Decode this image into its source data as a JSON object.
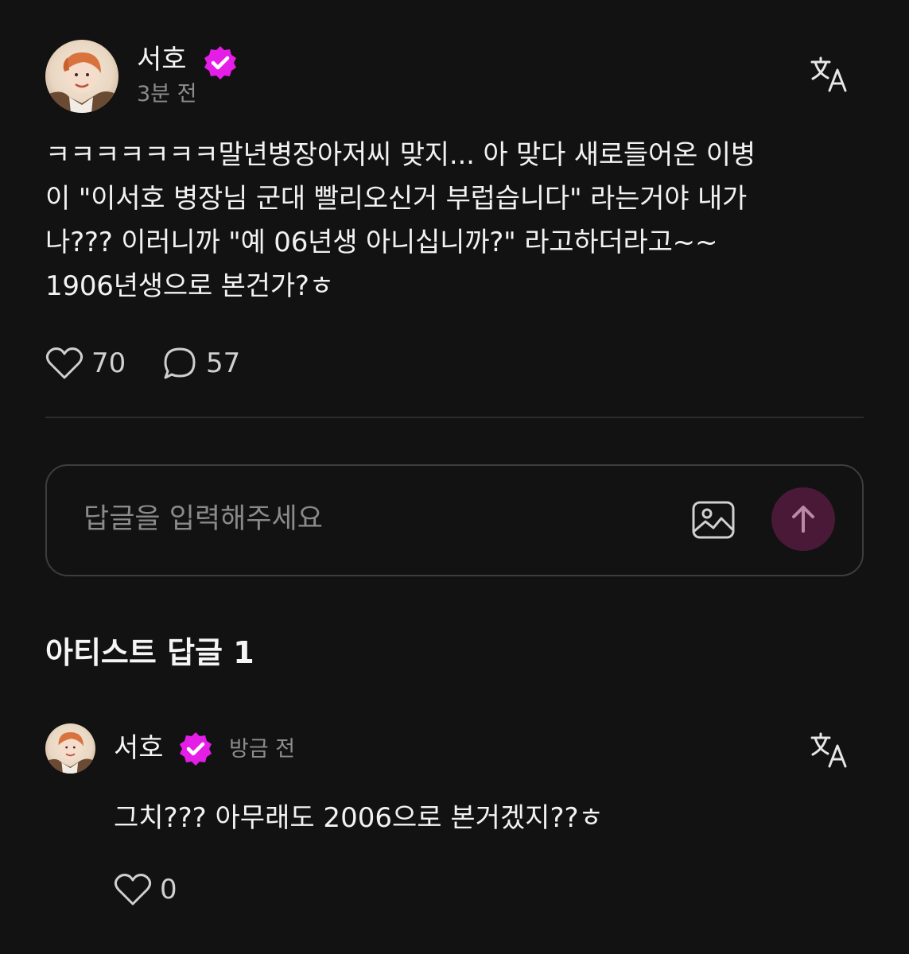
{
  "post": {
    "author": "서호",
    "time": "3분 전",
    "body_lines": [
      "ㅋㅋㅋㅋㅋㅋㅋ말년병장아저씨 맞지... 아 맞다 새로들어온 이병",
      "이 \"이서호 병장님 군대 빨리오신거 부럽습니다\" 라는거야 내가",
      "나??? 이러니까 \"예 06년생 아니십니까?\" 라고하더라고~~",
      "1906년생으로 본건가?ㅎ"
    ],
    "likes": "70",
    "comments": "57"
  },
  "reply_box": {
    "placeholder": "답글을 입력해주세요"
  },
  "artist_replies": {
    "title": "아티스트 답글 1",
    "items": [
      {
        "author": "서호",
        "time": "방금 전",
        "body": "그치??? 아무래도 2006으로 본거겠지??ㅎ",
        "likes": "0"
      }
    ]
  },
  "icons": {
    "verified": "verified-badge-icon",
    "translate": "translate-icon",
    "like": "heart-icon",
    "comment": "comment-bubble-icon",
    "image": "image-icon",
    "send": "arrow-up-icon"
  },
  "colors": {
    "background": "#121212",
    "verified_badge": "#e41ee6",
    "send_button": "#4a1937",
    "muted_text": "#8c8c8c"
  }
}
